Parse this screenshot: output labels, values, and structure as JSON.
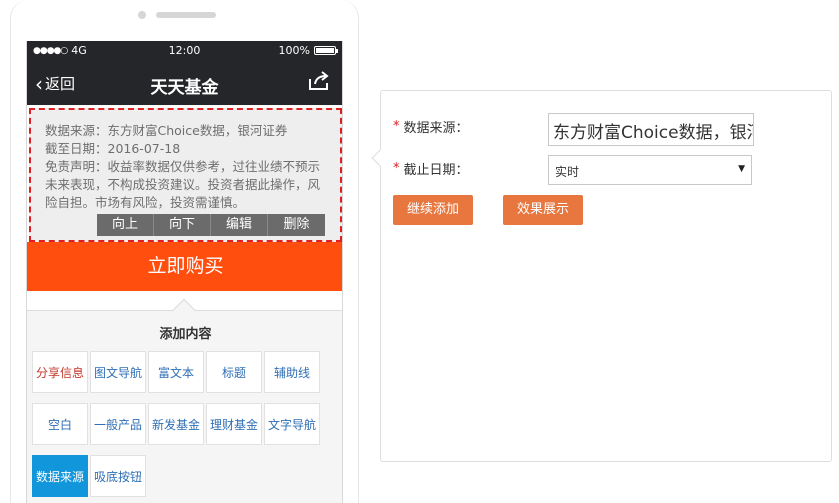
{
  "statusbar": {
    "signal": "●●●●○",
    "network": "4G",
    "time": "12:00",
    "battery": "100%",
    "battery_level": 1.0
  },
  "navbar": {
    "back_label": "返回",
    "title": "天天基金"
  },
  "source_block": {
    "line1": "数据来源：东方财富Choice数据，银河证券",
    "line2": "截至日期：2016-07-18",
    "line3": "免责声明：收益率数据仅供参考，过往业绩不预示未来表现，不构成投资建议。投资者据此操作，风险自担。市场有风险，投资需谨慎。"
  },
  "ops": {
    "up": "向上",
    "down": "向下",
    "edit": "编辑",
    "delete": "删除"
  },
  "buy_button": "立即购买",
  "add_panel": {
    "heading": "添加内容",
    "tiles": [
      "分享信息",
      "图文导航",
      "富文本",
      "标题",
      "辅助线",
      "空白",
      "一般产品",
      "新发基金",
      "理财基金",
      "文字导航",
      "数据来源",
      "吸底按钮"
    ]
  },
  "config": {
    "source_label": "数据来源：",
    "source_value": "东方财富Choice数据，银河证券",
    "date_label": "截止日期：",
    "date_value": "实时",
    "continue_button": "继续添加",
    "preview_button": "效果展示"
  },
  "colors": {
    "accent": "#ff4e0e",
    "button": "#e8773f",
    "active_tile": "#1296db",
    "dark_bar": "#252629"
  }
}
